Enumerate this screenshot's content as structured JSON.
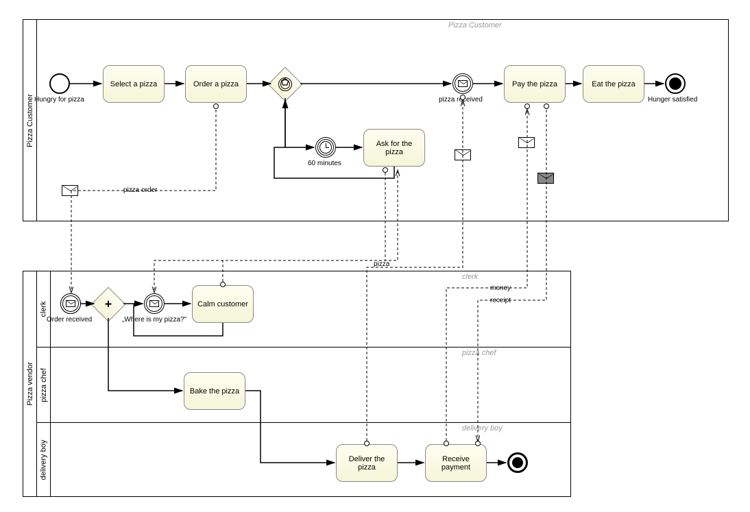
{
  "pools": {
    "customer": {
      "name": "Pizza Customer",
      "title": "Pizza Customer"
    },
    "vendor": {
      "name": "Pizza vendor",
      "lanes": {
        "clerk": {
          "name": "clerk",
          "title": "clerk"
        },
        "chef": {
          "name": "pizza chef",
          "title": "pizza chef"
        },
        "delivery": {
          "name": "delivery boy",
          "title": "delivery boy"
        }
      }
    }
  },
  "tasks": {
    "select": "Select a pizza",
    "order": "Order a pizza",
    "ask": "Ask for the pizza",
    "pay": "Pay the pizza",
    "eat": "Eat the pizza",
    "calm": "Calm customer",
    "bake": "Bake the pizza",
    "deliver": "Deliver the pizza",
    "receive": "Receive payment"
  },
  "events": {
    "hungry": "Hungry for pizza",
    "satisfied": "Hunger satisfied",
    "timer": "60 minutes",
    "pizzaReceived": "pizza received",
    "orderReceived": "Order received",
    "whereIsPizza": "„Where is my pizza?\""
  },
  "messages": {
    "pizzaOrder": "pizza order",
    "pizza": "pizza",
    "money": "money",
    "receipt": "receipt"
  }
}
